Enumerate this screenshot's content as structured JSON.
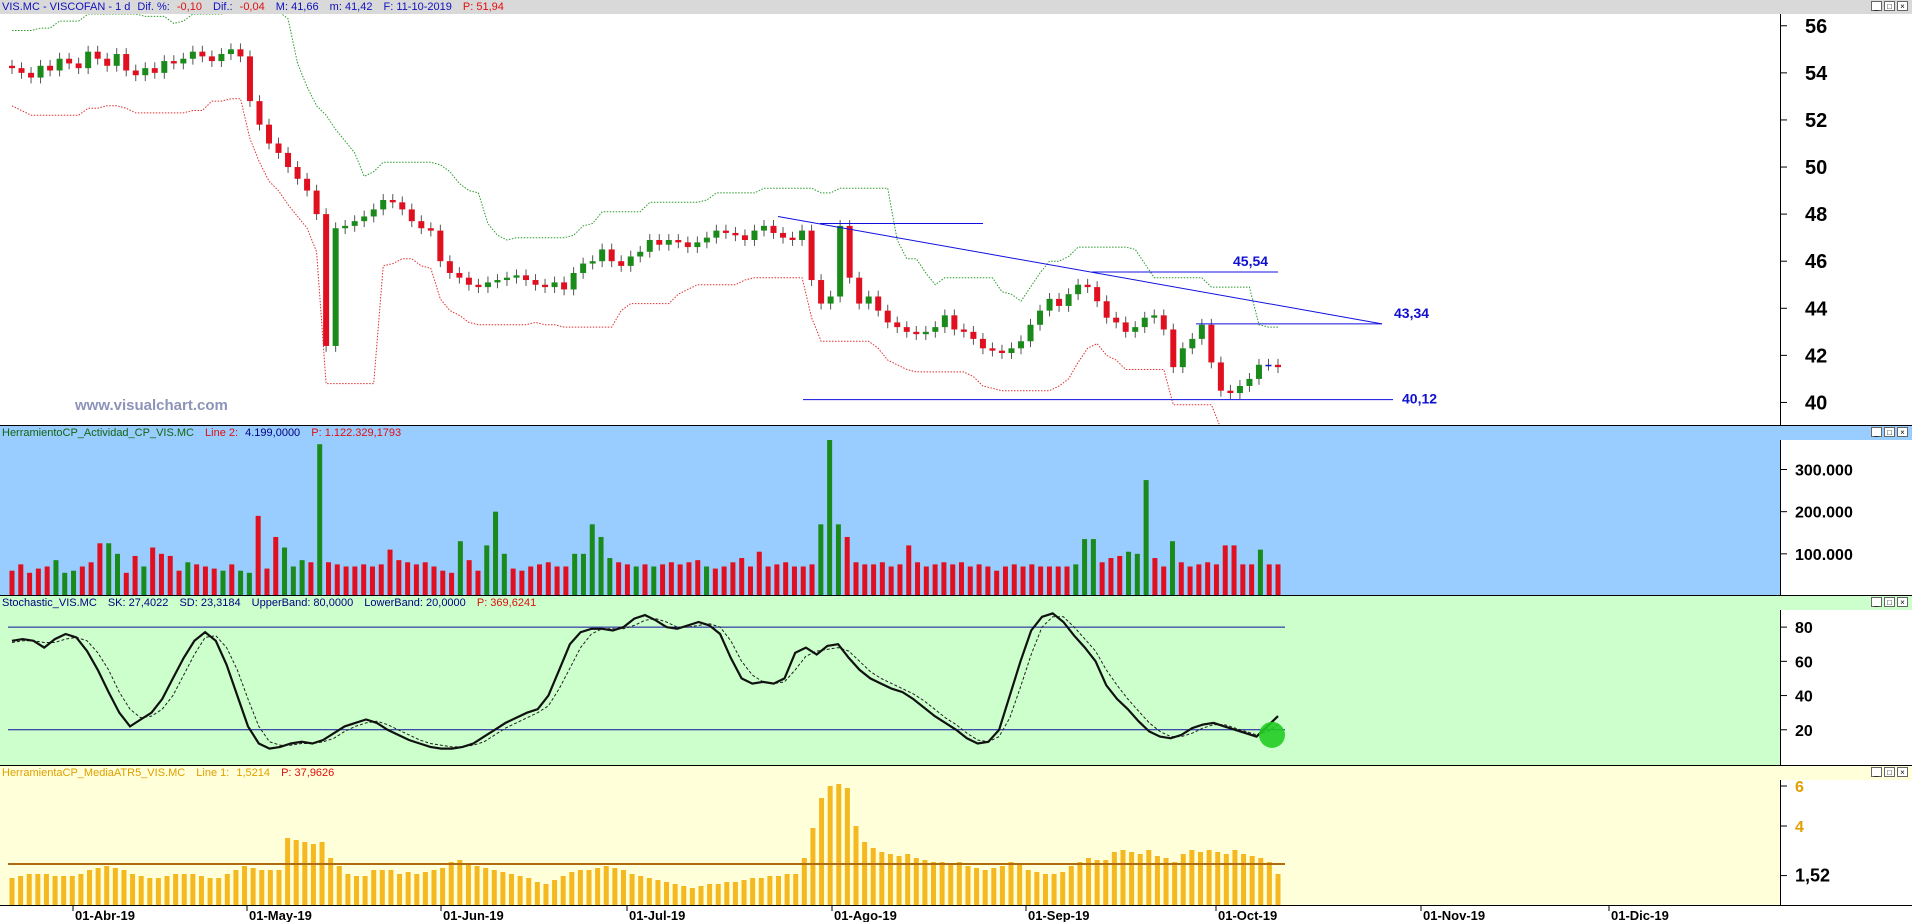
{
  "header": {
    "symbol": "VIS.MC - VISCOFAN -  1 d",
    "dif_pct_label": "Dif. %:",
    "dif_pct_value": "-0,10",
    "dif_label": "Dif.:",
    "dif_value": "-0,04",
    "max_label": "M: 41,66",
    "min_label": "m: 41,42",
    "date_label": "F: 11-10-2019",
    "price_label": "P: 51,94"
  },
  "window_buttons": {
    "minimize": "_",
    "restore": "□",
    "close": "×"
  },
  "watermark": "www.visualchart.com",
  "colors": {
    "up": "#1a8a1a",
    "down": "#e01020",
    "neutral": "#1010d0",
    "line": "#1010e0"
  },
  "chart_data": [
    {
      "type": "candlestick",
      "panel": "price",
      "ylim": [
        39,
        56.5
      ],
      "yticks": [
        "56",
        "54",
        "52",
        "50",
        "48",
        "46",
        "44",
        "42",
        "40"
      ],
      "ytick_values": [
        56,
        54,
        52,
        50,
        48,
        46,
        44,
        42,
        40
      ],
      "close": [
        54.2,
        54.0,
        53.8,
        54.3,
        54.1,
        54.6,
        54.4,
        54.2,
        54.9,
        54.6,
        54.3,
        54.8,
        54.1,
        53.9,
        54.2,
        54.0,
        54.5,
        54.4,
        54.6,
        54.9,
        54.7,
        54.5,
        54.8,
        55.0,
        54.7,
        52.8,
        51.8,
        51.0,
        50.6,
        50.0,
        49.5,
        49.0,
        48.0,
        42.4,
        47.4,
        47.5,
        47.7,
        47.9,
        48.2,
        48.6,
        48.5,
        48.2,
        47.7,
        47.4,
        47.3,
        46.0,
        45.5,
        45.3,
        45.0,
        44.9,
        45.1,
        45.2,
        45.3,
        45.4,
        45.2,
        45.0,
        44.9,
        45.1,
        44.8,
        45.5,
        45.9,
        46.0,
        46.5,
        46.0,
        45.8,
        46.2,
        46.4,
        46.9,
        46.7,
        46.9,
        46.8,
        46.6,
        46.8,
        47.0,
        47.3,
        47.2,
        47.1,
        46.9,
        47.3,
        47.5,
        47.2,
        47.0,
        46.9,
        47.3,
        45.2,
        44.2,
        44.5,
        47.5,
        45.3,
        44.2,
        44.5,
        43.9,
        43.4,
        43.2,
        43.0,
        42.9,
        43.0,
        43.2,
        43.7,
        43.1,
        43.0,
        42.7,
        42.3,
        42.2,
        42.1,
        42.3,
        42.6,
        43.3,
        43.9,
        44.4,
        44.1,
        44.6,
        45.0,
        44.9,
        44.3,
        43.6,
        43.4,
        43.0,
        43.2,
        43.6,
        43.7,
        43.1,
        41.5,
        42.3,
        42.7,
        43.3,
        41.7,
        40.5,
        40.4,
        40.7,
        41.0,
        41.6,
        41.6,
        41.5
      ],
      "labels": [
        {
          "text": "45,54",
          "value": 45.54
        },
        {
          "text": "43,34",
          "value": 43.34
        },
        {
          "text": "40,12",
          "value": 40.12
        }
      ]
    },
    {
      "type": "bar",
      "panel": "activity",
      "header": "HerramientoCP_Actividad_CP_VIS.MC",
      "line_label": "Line 2:",
      "line_value": "4.199,0000",
      "p_value": "P: 1.122.329,1793",
      "yticks": [
        "300.000",
        "200.000",
        "100.000"
      ],
      "ytick_values": [
        300000,
        200000,
        100000
      ],
      "ylim": [
        0,
        370000
      ],
      "values": [
        60,
        75,
        55,
        65,
        70,
        85,
        55,
        60,
        70,
        80,
        125,
        125,
        100,
        55,
        95,
        70,
        115,
        100,
        95,
        60,
        80,
        75,
        70,
        65,
        60,
        75,
        60,
        55,
        190,
        65,
        140,
        115,
        70,
        85,
        80,
        360,
        80,
        75,
        70,
        70,
        75,
        70,
        75,
        110,
        85,
        80,
        75,
        80,
        70,
        60,
        55,
        130,
        85,
        60,
        120,
        200,
        100,
        65,
        60,
        70,
        75,
        80,
        70,
        70,
        100,
        100,
        170,
        140,
        90,
        80,
        75,
        70,
        75,
        70,
        75,
        80,
        75,
        80,
        85,
        70,
        65,
        70,
        80,
        90,
        70,
        105,
        70,
        75,
        80,
        70,
        70,
        75,
        170,
        370,
        170,
        140,
        80,
        75,
        75,
        80,
        70,
        75,
        120,
        80,
        70,
        75,
        80,
        75,
        80,
        70,
        75,
        70,
        60,
        70,
        75,
        70,
        75,
        70,
        70,
        70,
        70,
        75,
        135,
        135,
        80,
        90,
        95,
        105,
        100,
        275,
        90,
        70,
        130,
        80,
        70,
        75,
        80,
        75,
        120,
        120,
        75,
        75,
        110,
        75,
        75
      ],
      "up": [
        0,
        0,
        0,
        0,
        0,
        1,
        1,
        1,
        0,
        0,
        0,
        1,
        1,
        0,
        0,
        1,
        0,
        0,
        0,
        0,
        1,
        0,
        0,
        0,
        1,
        0,
        1,
        1,
        0,
        0,
        0,
        1,
        1,
        1,
        0,
        1,
        0,
        0,
        0,
        0,
        0,
        0,
        0,
        0,
        0,
        0,
        0,
        0,
        0,
        0,
        0,
        1,
        0,
        0,
        1,
        1,
        1,
        0,
        0,
        0,
        0,
        0,
        0,
        0,
        1,
        1,
        1,
        1,
        1,
        0,
        0,
        1,
        0,
        1,
        0,
        0,
        0,
        0,
        0,
        1,
        0,
        0,
        0,
        0,
        0,
        0,
        0,
        0,
        0,
        0,
        0,
        0,
        1,
        1,
        1,
        0,
        0,
        0,
        0,
        0,
        0,
        0,
        0,
        0,
        0,
        0,
        0,
        0,
        0,
        0,
        0,
        0,
        0,
        0,
        0,
        0,
        0,
        0,
        0,
        0,
        0,
        1,
        1,
        1,
        0,
        0,
        0,
        1,
        1,
        1,
        0,
        0,
        1,
        0,
        0,
        0,
        0,
        0,
        0,
        0,
        0,
        0,
        1,
        0,
        0
      ],
      "ylabel": ""
    },
    {
      "type": "line",
      "panel": "stochastic",
      "header": "Stochastic_VIS.MC",
      "sk_label": "SK: 27,4022",
      "sd_label": "SD: 23,3184",
      "upper_label": "UpperBand: 80,0000",
      "lower_label": "LowerBand: 20,0000",
      "p_value": "P: 369,6241",
      "ylim": [
        0,
        90
      ],
      "yticks": [
        "80",
        "60",
        "40",
        "20"
      ],
      "ytick_values": [
        80,
        60,
        40,
        20
      ],
      "bands": [
        80,
        20
      ],
      "sk": [
        72,
        73,
        72,
        68,
        73,
        76,
        74,
        66,
        55,
        42,
        30,
        22,
        26,
        30,
        38,
        50,
        62,
        72,
        77,
        72,
        58,
        40,
        22,
        12,
        9,
        10,
        12,
        13,
        12,
        14,
        18,
        22,
        24,
        26,
        24,
        20,
        17,
        14,
        12,
        10,
        9,
        9,
        10,
        12,
        16,
        20,
        24,
        27,
        30,
        32,
        40,
        55,
        70,
        77,
        79,
        79,
        78,
        80,
        85,
        87,
        84,
        80,
        79,
        81,
        83,
        81,
        76,
        62,
        50,
        47,
        48,
        47,
        50,
        65,
        68,
        64,
        69,
        70,
        62,
        55,
        50,
        47,
        44,
        42,
        38,
        33,
        28,
        24,
        20,
        15,
        12,
        13,
        20,
        40,
        60,
        78,
        86,
        88,
        83,
        75,
        68,
        60,
        46,
        38,
        32,
        25,
        19,
        16,
        15,
        17,
        21,
        23,
        24,
        22,
        20,
        18,
        16,
        22,
        28
      ],
      "sd": [
        71,
        72,
        72,
        71,
        71,
        73,
        74,
        72,
        65,
        55,
        42,
        32,
        27,
        28,
        32,
        40,
        52,
        64,
        74,
        75,
        68,
        55,
        38,
        22,
        13,
        11,
        11,
        12,
        12,
        13,
        15,
        19,
        22,
        24,
        25,
        23,
        20,
        17,
        14,
        12,
        11,
        10,
        10,
        11,
        13,
        17,
        21,
        24,
        27,
        30,
        34,
        44,
        56,
        68,
        76,
        79,
        79,
        79,
        81,
        84,
        85,
        83,
        80,
        80,
        81,
        82,
        80,
        72,
        60,
        52,
        48,
        47,
        48,
        55,
        63,
        66,
        67,
        68,
        66,
        60,
        54,
        50,
        47,
        44,
        41,
        37,
        32,
        27,
        23,
        18,
        14,
        13,
        16,
        27,
        45,
        64,
        80,
        86,
        86,
        80,
        73,
        66,
        55,
        46,
        38,
        31,
        24,
        19,
        16,
        16,
        18,
        21,
        23,
        23,
        21,
        19,
        17,
        19,
        23
      ],
      "ylabel": ""
    },
    {
      "type": "bar",
      "panel": "atr",
      "header": "HerramientaCP_MediaATR5_VIS.MC",
      "line_label": "Line 1:",
      "line_value": "1,5214",
      "p_value": "P: 37,9626",
      "ylim": [
        0,
        6.3
      ],
      "yticks": [
        "6",
        "4",
        "1,52"
      ],
      "ytick_values": [
        6,
        4,
        1.52
      ],
      "last_value_label": "1,52",
      "avg_value": 2.1,
      "values": [
        1.4,
        1.5,
        1.6,
        1.6,
        1.6,
        1.5,
        1.5,
        1.5,
        1.6,
        1.8,
        1.9,
        2.0,
        1.9,
        1.8,
        1.6,
        1.5,
        1.4,
        1.4,
        1.5,
        1.6,
        1.6,
        1.6,
        1.5,
        1.4,
        1.4,
        1.6,
        1.8,
        2.0,
        1.9,
        1.8,
        1.8,
        1.8,
        3.4,
        3.3,
        3.2,
        3.1,
        3.2,
        2.4,
        2.0,
        1.6,
        1.5,
        1.5,
        1.8,
        1.8,
        1.8,
        1.6,
        1.7,
        1.6,
        1.7,
        1.8,
        1.9,
        2.2,
        2.3,
        2.1,
        2.0,
        1.9,
        1.8,
        1.7,
        1.6,
        1.5,
        1.4,
        1.2,
        1.1,
        1.3,
        1.5,
        1.7,
        1.8,
        1.8,
        1.9,
        2.0,
        1.9,
        1.8,
        1.6,
        1.5,
        1.4,
        1.3,
        1.2,
        1.1,
        1.0,
        0.9,
        1.0,
        1.1,
        1.1,
        1.2,
        1.2,
        1.3,
        1.4,
        1.4,
        1.5,
        1.5,
        1.6,
        1.6,
        2.4,
        3.9,
        5.4,
        6.0,
        6.1,
        5.9,
        4.0,
        3.2,
        2.9,
        2.7,
        2.6,
        2.5,
        2.6,
        2.4,
        2.3,
        2.2,
        2.2,
        2.1,
        2.2,
        2.0,
        1.9,
        1.8,
        1.9,
        2.0,
        2.2,
        2.1,
        1.8,
        1.7,
        1.6,
        1.6,
        1.7,
        2.0,
        2.2,
        2.4,
        2.3,
        2.3,
        2.7,
        2.8,
        2.7,
        2.6,
        2.8,
        2.5,
        2.4,
        2.2,
        2.6,
        2.8,
        2.7,
        2.8,
        2.7,
        2.6,
        2.8,
        2.6,
        2.5,
        2.4,
        2.2,
        1.6
      ],
      "ylabel": ""
    }
  ],
  "xaxis": {
    "labels": [
      "01-Abr-19",
      "01-May-19",
      "01-Jun-19",
      "01-Jul-19",
      "01-Ago-19",
      "01-Sep-19",
      "01-Oct-19",
      "01-Nov-19",
      "01-Dic-19"
    ]
  }
}
